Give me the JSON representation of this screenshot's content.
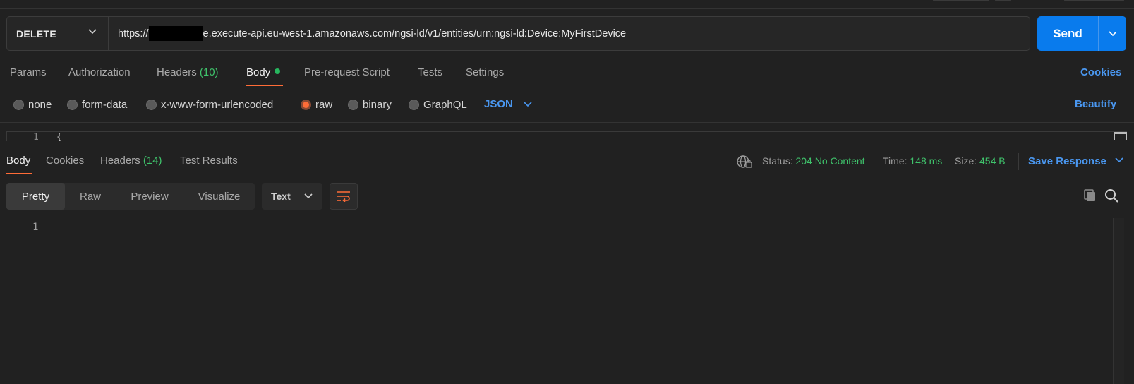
{
  "request": {
    "method": "DELETE",
    "url_prefix": "https://",
    "url_rest": "e.execute-api.eu-west-1.amazonaws.com/ngsi-ld/v1/entities/urn:ngsi-ld:Device:MyFirstDevice",
    "send_label": "Send"
  },
  "request_tabs": {
    "params": "Params",
    "authorization": "Authorization",
    "headers": "Headers",
    "headers_count": "(10)",
    "body": "Body",
    "prerequest": "Pre-request Script",
    "tests": "Tests",
    "settings": "Settings",
    "cookies": "Cookies"
  },
  "body_types": {
    "none": "none",
    "form_data": "form-data",
    "urlencoded": "x-www-form-urlencoded",
    "raw": "raw",
    "binary": "binary",
    "graphql": "GraphQL",
    "selected": "raw",
    "format": "JSON",
    "beautify": "Beautify"
  },
  "editor": {
    "line_number": "1",
    "first_line": "{"
  },
  "response_tabs": {
    "body": "Body",
    "cookies": "Cookies",
    "headers": "Headers",
    "headers_count": "(14)",
    "test_results": "Test Results"
  },
  "response_meta": {
    "status_label": "Status:",
    "status_value": "204 No Content",
    "time_label": "Time:",
    "time_value": "148 ms",
    "size_label": "Size:",
    "size_value": "454 B",
    "save_response": "Save Response"
  },
  "response_view": {
    "pretty": "Pretty",
    "raw": "Raw",
    "preview": "Preview",
    "visualize": "Visualize",
    "format": "Text",
    "line_number": "1"
  },
  "colors": {
    "accent_orange": "#ff6c37",
    "send_blue": "#097bed",
    "link_blue": "#4a97f0",
    "success_green": "#3fc26b",
    "background": "#212121"
  }
}
